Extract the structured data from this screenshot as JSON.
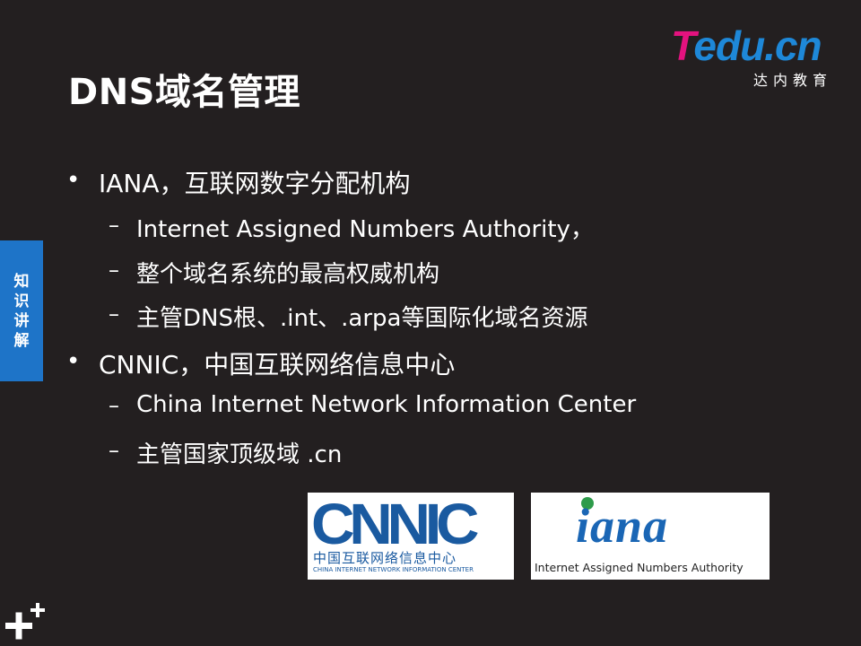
{
  "slide": {
    "title": "DNS域名管理"
  },
  "logo": {
    "brand_t": "T",
    "brand_rest": "edu.cn",
    "subtitle": "达内教育"
  },
  "side_tab": {
    "chars": [
      "知",
      "识",
      "讲",
      "解"
    ]
  },
  "bullets": [
    {
      "text": "IANA，互联网数字分配机构",
      "subitems": [
        "Internet Assigned Numbers Authority，",
        "整个域名系统的最高权威机构",
        "主管DNS根、.int、.arpa等国际化域名资源"
      ]
    },
    {
      "text": "CNNIC，中国互联网络信息中心",
      "subitems": [
        "China Internet Network Information Center",
        "主管国家顶级域 .cn"
      ]
    }
  ],
  "images": {
    "cnnic": {
      "wordmark": "CNNIC",
      "cn_text": "中国互联网络信息中心",
      "en_text": "CHINA INTERNET NETWORK INFORMATION CENTER"
    },
    "iana": {
      "wordmark": "iana",
      "caption": "Internet Assigned Numbers Authority"
    }
  },
  "colors": {
    "background": "#231f20",
    "side_tab": "#1e74c8",
    "logo_magenta": "#e4127f",
    "logo_blue": "#1e88d8"
  }
}
